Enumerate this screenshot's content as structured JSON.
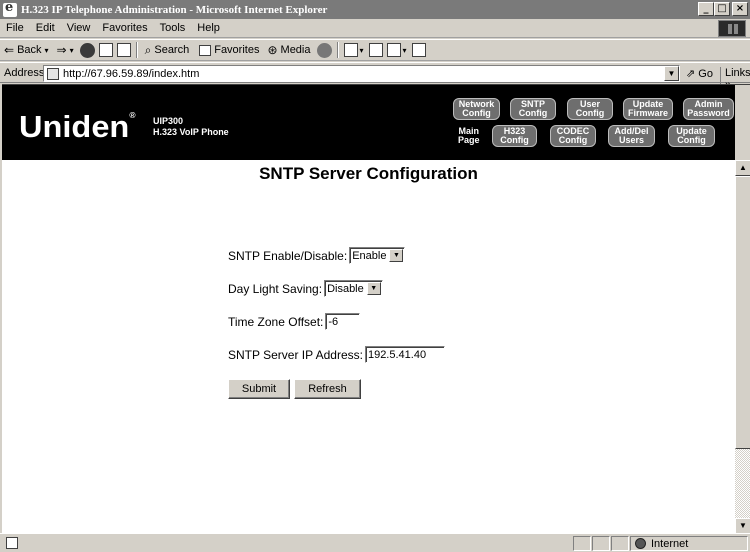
{
  "window": {
    "title": "H.323 IP Telephone Administration - Microsoft Internet Explorer"
  },
  "menu": [
    "File",
    "Edit",
    "View",
    "Favorites",
    "Tools",
    "Help"
  ],
  "toolbar": {
    "back": "Back",
    "search": "Search",
    "favorites": "Favorites",
    "media": "Media"
  },
  "address": {
    "label": "Address",
    "url": "http://67.96.59.89/index.htm",
    "go": "Go",
    "links": "Links »"
  },
  "header": {
    "brand": "Uniden",
    "model_line1": "UIP300",
    "model_line2": "H.323 VoIP Phone",
    "nav_top": [
      {
        "l1": "Network",
        "l2": "Config"
      },
      {
        "l1": "SNTP",
        "l2": "Config"
      },
      {
        "l1": "User",
        "l2": "Config"
      },
      {
        "l1": "Update",
        "l2": "Firmware"
      },
      {
        "l1": "Admin",
        "l2": "Password"
      }
    ],
    "main_page": {
      "l1": "Main",
      "l2": "Page"
    },
    "nav_bottom": [
      {
        "l1": "H323",
        "l2": "Config"
      },
      {
        "l1": "CODEC",
        "l2": "Config"
      },
      {
        "l1": "Add/Del",
        "l2": "Users"
      },
      {
        "l1": "Update",
        "l2": "Config"
      }
    ]
  },
  "page": {
    "title": "SNTP Server Configuration",
    "fields": {
      "sntp_enable": {
        "label": "SNTP Enable/Disable:",
        "value": "Enable"
      },
      "daylight": {
        "label": "Day Light Saving:",
        "value": "Disable"
      },
      "tz_offset": {
        "label": "Time Zone Offset:",
        "value": "-6"
      },
      "server_ip": {
        "label": "SNTP Server IP Address:",
        "value": "192.5.41.40"
      }
    },
    "submit": "Submit",
    "refresh": "Refresh"
  },
  "status": {
    "zone": "Internet"
  }
}
